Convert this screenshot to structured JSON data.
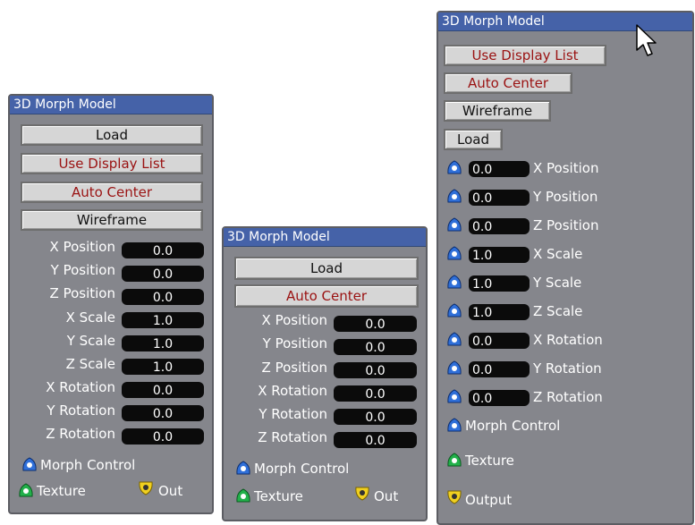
{
  "panel1": {
    "title": "3D Morph Model",
    "buttons": [
      "Load",
      "Use Display List",
      "Auto Center",
      "Wireframe"
    ],
    "params": [
      {
        "label": "X Position",
        "value": "0.0"
      },
      {
        "label": "Y Position",
        "value": "0.0"
      },
      {
        "label": "Z Position",
        "value": "0.0"
      },
      {
        "label": "X Scale",
        "value": "1.0"
      },
      {
        "label": "Y Scale",
        "value": "1.0"
      },
      {
        "label": "Z Scale",
        "value": "1.0"
      },
      {
        "label": "X Rotation",
        "value": "0.0"
      },
      {
        "label": "Y Rotation",
        "value": "0.0"
      },
      {
        "label": "Z Rotation",
        "value": "0.0"
      }
    ],
    "morph_control": "Morph Control",
    "texture": "Texture",
    "out": "Out"
  },
  "panel2": {
    "title": "3D Morph Model",
    "buttons": [
      "Load",
      "Auto Center"
    ],
    "params": [
      {
        "label": "X Position",
        "value": "0.0"
      },
      {
        "label": "Y Position",
        "value": "0.0"
      },
      {
        "label": "Z Position",
        "value": "0.0"
      },
      {
        "label": "X Rotation",
        "value": "0.0"
      },
      {
        "label": "Y Rotation",
        "value": "0.0"
      },
      {
        "label": "Z Rotation",
        "value": "0.0"
      }
    ],
    "morph_control": "Morph Control",
    "texture": "Texture",
    "out": "Out"
  },
  "panel3": {
    "title": "3D Morph Model",
    "buttons": [
      "Use Display List",
      "Auto Center",
      "Wireframe",
      "Load"
    ],
    "params": [
      {
        "label": "X Position",
        "value": "0.0"
      },
      {
        "label": "Y Position",
        "value": "0.0"
      },
      {
        "label": "Z Position",
        "value": "0.0"
      },
      {
        "label": "X Scale",
        "value": "1.0"
      },
      {
        "label": "Y Scale",
        "value": "1.0"
      },
      {
        "label": "Z Scale",
        "value": "1.0"
      },
      {
        "label": "X Rotation",
        "value": "0.0"
      },
      {
        "label": "Y Rotation",
        "value": "0.0"
      },
      {
        "label": "Z Rotation",
        "value": "0.0"
      }
    ],
    "morph_control": "Morph Control",
    "texture": "Texture",
    "output": "Output"
  },
  "colors": {
    "panel_bg": "#85868c",
    "title_bar": "#4562a8",
    "pin_blue": "#2f6fd8",
    "pin_green": "#22b04a",
    "pin_yellow": "#f0d020",
    "red_text": "#9a1212"
  },
  "icons": [
    "blue-input-pin-icon",
    "green-texture-pin-icon",
    "yellow-output-pin-icon",
    "mouse-cursor-icon"
  ]
}
